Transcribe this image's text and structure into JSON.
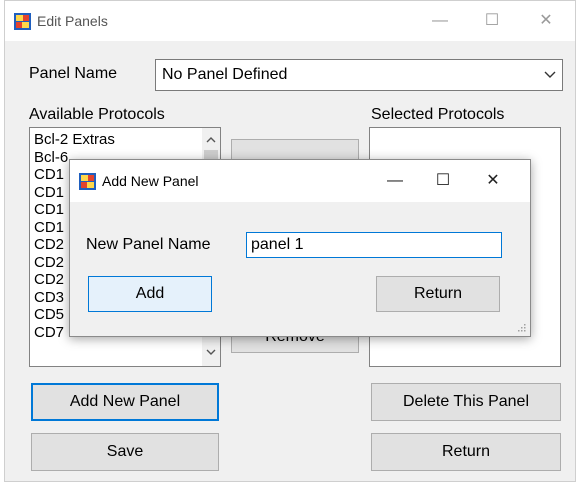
{
  "window": {
    "title": "Edit Panels",
    "controls": {
      "minimize": "—",
      "maximize": "☐",
      "close": "✕"
    }
  },
  "panel_name": {
    "label": "Panel Name",
    "value": "No Panel Defined"
  },
  "available": {
    "label": "Available Protocols",
    "items": [
      "Bcl-2 Extras",
      "Bcl-6",
      "CD1",
      "CD1",
      "CD1",
      "CD1",
      "CD2",
      "CD2",
      "CD2",
      "CD3",
      "CD5",
      "CD7"
    ]
  },
  "selected": {
    "label": "Selected Protocols",
    "items": []
  },
  "middle_buttons": {
    "add_label": "",
    "remove_label": "Remove"
  },
  "buttons": {
    "add_new_panel": "Add New Panel",
    "delete_panel": "Delete This Panel",
    "save": "Save",
    "return": "Return"
  },
  "dialog": {
    "title": "Add New Panel",
    "controls": {
      "minimize": "—",
      "maximize": "☐",
      "close": "✕"
    },
    "field_label": "New Panel Name",
    "field_value": "panel 1",
    "add_label": "Add",
    "return_label": "Return"
  },
  "colors": {
    "accent": "#0078d7",
    "window_bg": "#f0f0f0",
    "button_bg": "#e1e1e1"
  }
}
